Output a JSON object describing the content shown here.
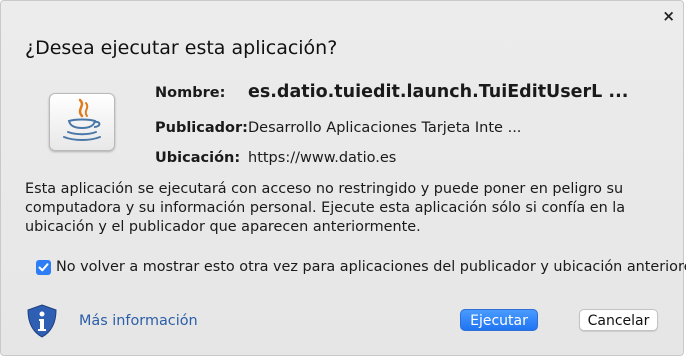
{
  "dialog": {
    "close_glyph": "×",
    "title": "¿Desea ejecutar esta aplicación?",
    "icon": "java-coffee-icon",
    "info": {
      "name_label": "Nombre:",
      "name_value": "es.datio.tuiedit.launch.TuiEditUserL ...",
      "publisher_label": "Publicador:",
      "publisher_value": "Desarrollo Aplicaciones Tarjeta Inte ...",
      "location_label": "Ubicación:",
      "location_value": "https://www.datio.es"
    },
    "message": "Esta aplicación se ejecutará con acceso no restringido y puede poner en peligro su computadora y su información personal. Ejecute esta aplicación sólo si confía en la ubicación y el publicador que aparecen anteriormente.",
    "checkbox": {
      "checked": true,
      "label": "No volver a mostrar esto otra vez para aplicaciones del publicador y ubicación anteriores"
    },
    "more_info_label": "Más información",
    "buttons": {
      "run": "Ejecutar",
      "cancel": "Cancelar"
    },
    "colors": {
      "accent": "#1f74f2",
      "link": "#2b5ea8",
      "shield": "#2f5fb3"
    }
  }
}
